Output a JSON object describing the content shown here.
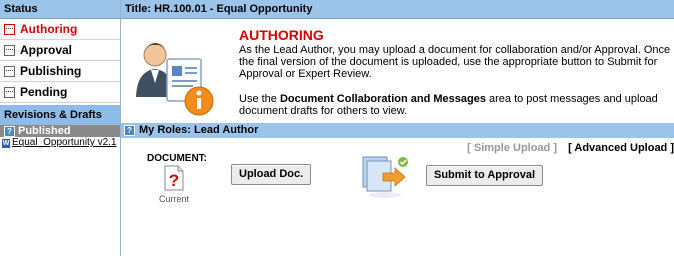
{
  "sidebar": {
    "header": "Status",
    "items": [
      {
        "label": "Authoring",
        "active": true
      },
      {
        "label": "Approval",
        "active": false
      },
      {
        "label": "Publishing",
        "active": false
      },
      {
        "label": "Pending",
        "active": false
      }
    ],
    "section_header": "Revisions & Drafts",
    "published_header": "Published",
    "published_docs": [
      "Equal_Opportunity v2.1"
    ]
  },
  "main": {
    "title": "Title: HR.100.01 - Equal Opportunity",
    "heading": "AUTHORING",
    "description_1": "As the Lead Author, you may upload a document for collaboration and/or Approval. Once the final version of the document is uploaded, use the appropriate button to Submit for Approval or Expert Review.",
    "description_2_prefix": "Use the ",
    "description_2_bold": "Document Collaboration and Messages",
    "description_2_suffix": " area to post messages and upload document drafts for others to view.",
    "roles_label": "My Roles: Lead Author",
    "simple_upload": "[ Simple Upload ]",
    "advanced_upload": "[ Advanced Upload ]",
    "document_label": "DOCUMENT:",
    "current_label": "Current",
    "upload_button": "Upload Doc.",
    "submit_button": "Submit to Approval"
  },
  "icons": {
    "help": "question-icon",
    "person": "lead-author-info-icon",
    "document": "unknown-document-icon",
    "submit": "submit-approval-icon"
  },
  "colors": {
    "header_bg": "#9cc3ea",
    "active_text": "#d40000",
    "published_bg": "#8a8a8a"
  }
}
